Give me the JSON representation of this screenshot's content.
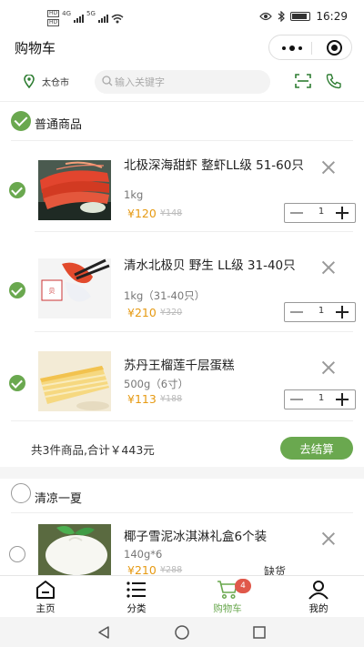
{
  "status_bar": {
    "left_badges": [
      "HD",
      "HD"
    ],
    "network": [
      "4G",
      "5G"
    ],
    "time": "16:29"
  },
  "header": {
    "title": "购物车"
  },
  "search": {
    "location": "太仓市",
    "placeholder": "输入关键字"
  },
  "groups": [
    {
      "title": "普通商品",
      "checked": true,
      "items": [
        {
          "name": "北极深海甜虾 整虾LL级 51-60只",
          "spec": "1kg",
          "price": "¥120",
          "old_price": "¥148",
          "qty": "1",
          "checked": true,
          "image": "shrimp-image"
        },
        {
          "name": "清水北极贝 野生 LL级 31-40只",
          "spec": "1kg（31-40只）",
          "price": "¥210",
          "old_price": "¥320",
          "qty": "1",
          "checked": true,
          "image": "surf-clam-image"
        },
        {
          "name": "苏丹王榴莲千层蛋糕",
          "spec": "500g（6寸）",
          "price": "¥113",
          "old_price": "¥188",
          "qty": "1",
          "checked": true,
          "image": "durian-crepe-cake-image"
        }
      ],
      "summary": "共3件商品,合计￥443元",
      "checkout_label": "去结算"
    },
    {
      "title": "清凉一夏",
      "checked": false,
      "items": [
        {
          "name": "椰子雪泥冰淇淋礼盒6个装",
          "spec": "140g*6",
          "price": "¥210",
          "old_price": "¥288",
          "status": "缺货",
          "checked": false,
          "image": "coconut-ice-cream-image"
        }
      ]
    }
  ],
  "bottom_nav": [
    {
      "label": "主页",
      "icon": "home-icon",
      "active": false
    },
    {
      "label": "分类",
      "icon": "category-list-icon",
      "active": false
    },
    {
      "label": "购物车",
      "icon": "cart-icon",
      "active": true,
      "badge": "4"
    },
    {
      "label": "我的",
      "icon": "person-icon",
      "active": false
    }
  ],
  "system_nav": [
    "back-icon",
    "home-circle-icon",
    "recents-icon"
  ],
  "colors": {
    "accent": "#6aa84f",
    "price": "#e69a13",
    "badge": "#e0584a"
  }
}
